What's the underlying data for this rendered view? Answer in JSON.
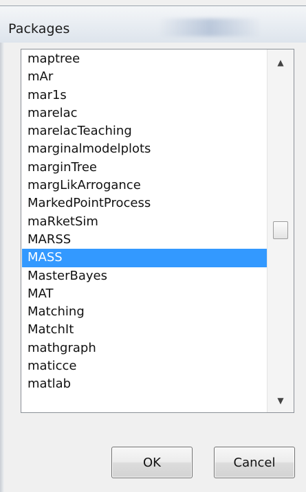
{
  "window": {
    "title": "Packages"
  },
  "packages": {
    "items": [
      "maptree",
      "mAr",
      "mar1s",
      "marelac",
      "marelacTeaching",
      "marginalmodelplots",
      "marginTree",
      "margLikArrogance",
      "MarkedPointProcess",
      "maRketSim",
      "MARSS",
      "MASS",
      "MasterBayes",
      "MAT",
      "Matching",
      "MatchIt",
      "mathgraph",
      "maticce",
      "matlab"
    ],
    "selected": "MASS"
  },
  "buttons": {
    "ok_label": "OK",
    "cancel_label": "Cancel"
  },
  "icons": {
    "scroll_up": "scroll-up-arrow-icon",
    "scroll_down": "scroll-down-arrow-icon"
  },
  "colors": {
    "selection": "#3399ff",
    "selection_text": "#ffffff"
  }
}
